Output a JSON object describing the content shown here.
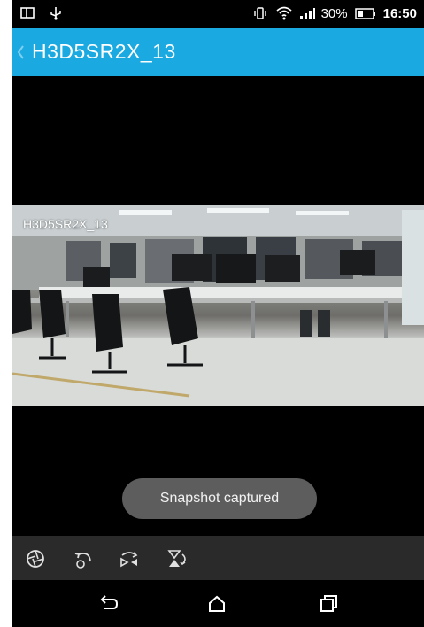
{
  "status_bar": {
    "left_icons": [
      "screen-mirror-icon",
      "usb-icon"
    ],
    "right_icons": [
      "vibrate-icon",
      "wifi-icon",
      "signal-icon",
      "battery-icon"
    ],
    "battery_percent": "30%",
    "time": "16:50"
  },
  "app_bar": {
    "title": "H3D5SR2X_13",
    "back_icon": "chevron-left-icon",
    "background_color": "#1ba9e1"
  },
  "video": {
    "overlay_label": "H3D5SR2X_13"
  },
  "toast": {
    "message": "Snapshot captured"
  },
  "toolbar": {
    "buttons": [
      {
        "icon": "aperture-icon"
      },
      {
        "icon": "rotate-icon"
      },
      {
        "icon": "flip-horizontal-icon"
      },
      {
        "icon": "flip-vertical-icon"
      }
    ]
  },
  "nav_bar": {
    "buttons": [
      {
        "icon": "back-icon"
      },
      {
        "icon": "home-icon"
      },
      {
        "icon": "recents-icon"
      }
    ]
  }
}
